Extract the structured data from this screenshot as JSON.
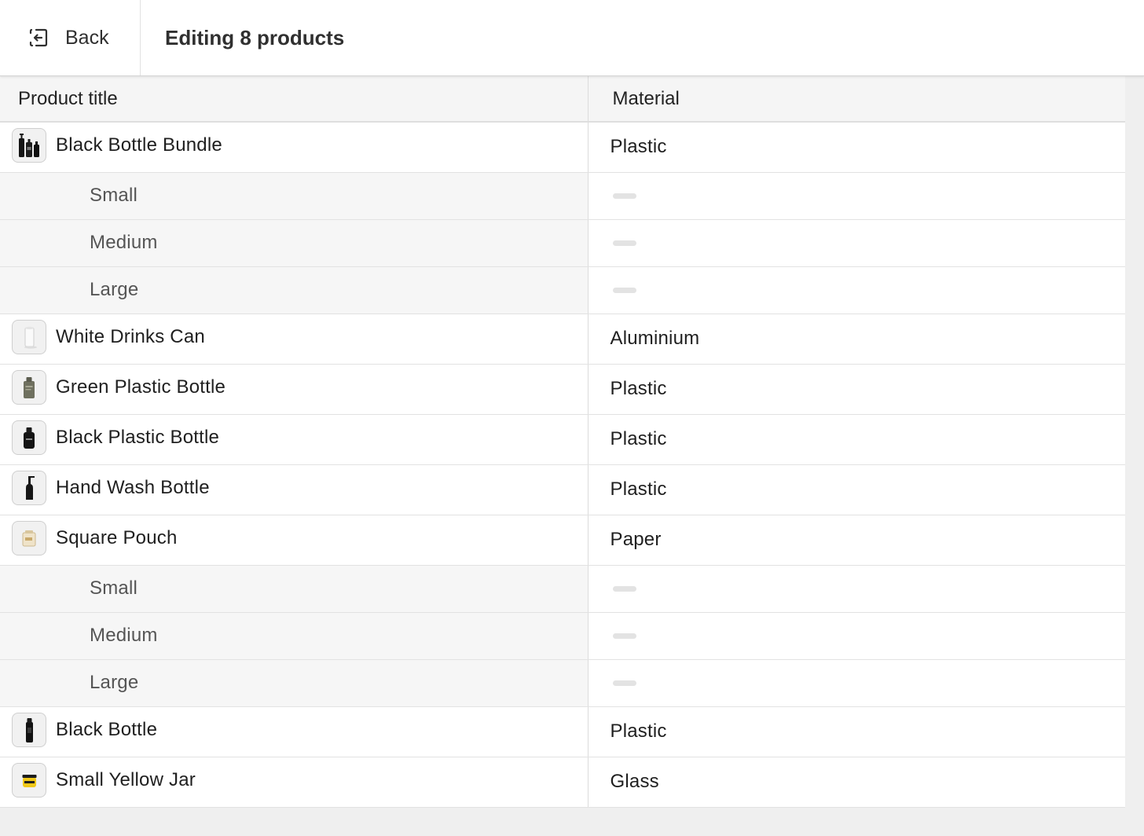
{
  "header": {
    "back_label": "Back",
    "title": "Editing 8 products",
    "back_icon": "exit-arrow-icon"
  },
  "table": {
    "columns": [
      "Product title",
      "Material"
    ],
    "rows": [
      {
        "type": "product",
        "title": "Black Bottle Bundle",
        "value": "Plastic",
        "thumb": "bottle-bundle"
      },
      {
        "type": "variant",
        "title": "Small"
      },
      {
        "type": "variant",
        "title": "Medium"
      },
      {
        "type": "variant",
        "title": "Large"
      },
      {
        "type": "product",
        "title": "White Drinks Can",
        "value": "Aluminium",
        "thumb": "white-can"
      },
      {
        "type": "product",
        "title": "Green Plastic Bottle",
        "value": "Plastic",
        "thumb": "green-bottle"
      },
      {
        "type": "product",
        "title": "Black Plastic Bottle",
        "value": "Plastic",
        "thumb": "black-square-bottle"
      },
      {
        "type": "product",
        "title": "Hand Wash Bottle",
        "value": "Plastic",
        "thumb": "pump-bottle"
      },
      {
        "type": "product",
        "title": "Square Pouch",
        "value": "Paper",
        "thumb": "pouch"
      },
      {
        "type": "variant",
        "title": "Small"
      },
      {
        "type": "variant",
        "title": "Medium"
      },
      {
        "type": "variant",
        "title": "Large"
      },
      {
        "type": "product",
        "title": "Black Bottle",
        "value": "Plastic",
        "thumb": "tall-black-bottle"
      },
      {
        "type": "product",
        "title": "Small Yellow Jar",
        "value": "Glass",
        "thumb": "yellow-jar"
      }
    ]
  }
}
